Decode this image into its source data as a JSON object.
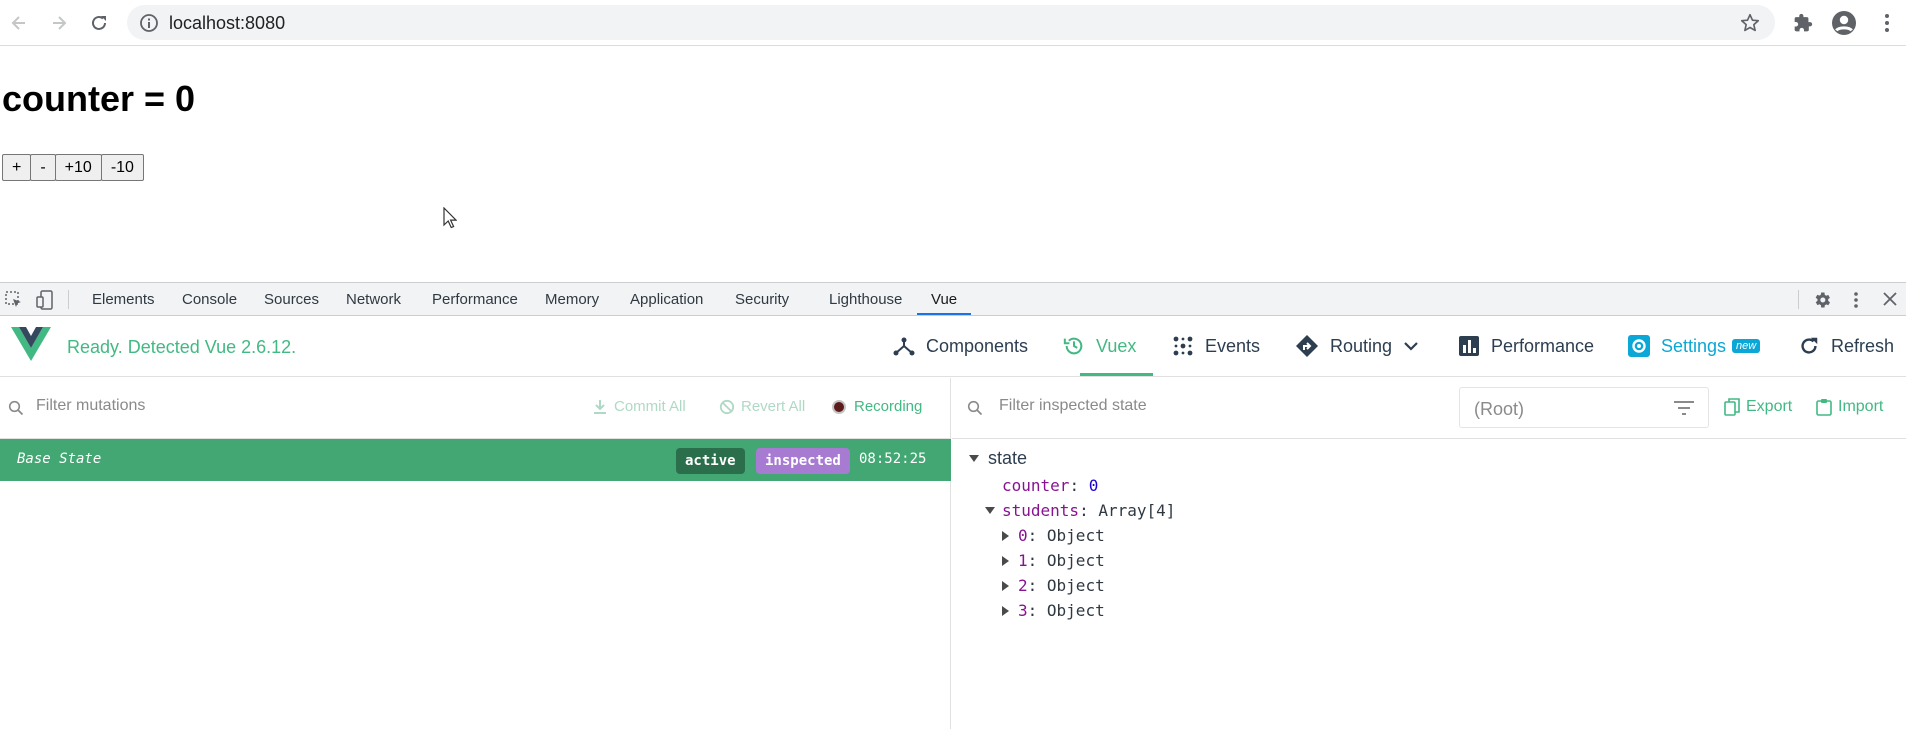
{
  "browser": {
    "url": "localhost:8080",
    "icons": [
      "back-arrow-icon",
      "forward-arrow-icon",
      "reload-icon",
      "info-icon",
      "star-icon",
      "extensions-puzzle-icon",
      "profile-icon",
      "menu-dots-icon"
    ]
  },
  "page": {
    "heading": "counter = 0",
    "buttons": [
      "+",
      "-",
      "+10",
      "-10"
    ]
  },
  "devtools": {
    "tabs": [
      "Elements",
      "Console",
      "Sources",
      "Network",
      "Performance",
      "Memory",
      "Application",
      "Security",
      "Lighthouse",
      "Vue"
    ],
    "active_tab": "Vue",
    "accent": "#1a73e8"
  },
  "vue": {
    "status": "Ready. Detected Vue 2.6.12.",
    "accent": "#42b983",
    "tabs": {
      "components": "Components",
      "vuex": "Vuex",
      "events": "Events",
      "routing": "Routing",
      "performance": "Performance",
      "settings": "Settings",
      "settings_badge": "new",
      "refresh": "Refresh"
    },
    "active_tab": "Vuex"
  },
  "mutations": {
    "filter_placeholder": "Filter mutations",
    "commit_all": "Commit All",
    "revert_all": "Revert All",
    "recording": "Recording",
    "rows": [
      {
        "label": "Base State",
        "badges": [
          "active",
          "inspected"
        ],
        "time": "08:52:25"
      }
    ]
  },
  "inspector": {
    "filter_placeholder": "Filter inspected state",
    "root_select": "(Root)",
    "export": "Export",
    "import": "Import",
    "section": "state",
    "counter_key": "counter",
    "counter_value": "0",
    "students_key": "students",
    "students_value": "Array[4]",
    "students": [
      {
        "index": "0",
        "value": "Object"
      },
      {
        "index": "1",
        "value": "Object"
      },
      {
        "index": "2",
        "value": "Object"
      },
      {
        "index": "3",
        "value": "Object"
      }
    ]
  }
}
